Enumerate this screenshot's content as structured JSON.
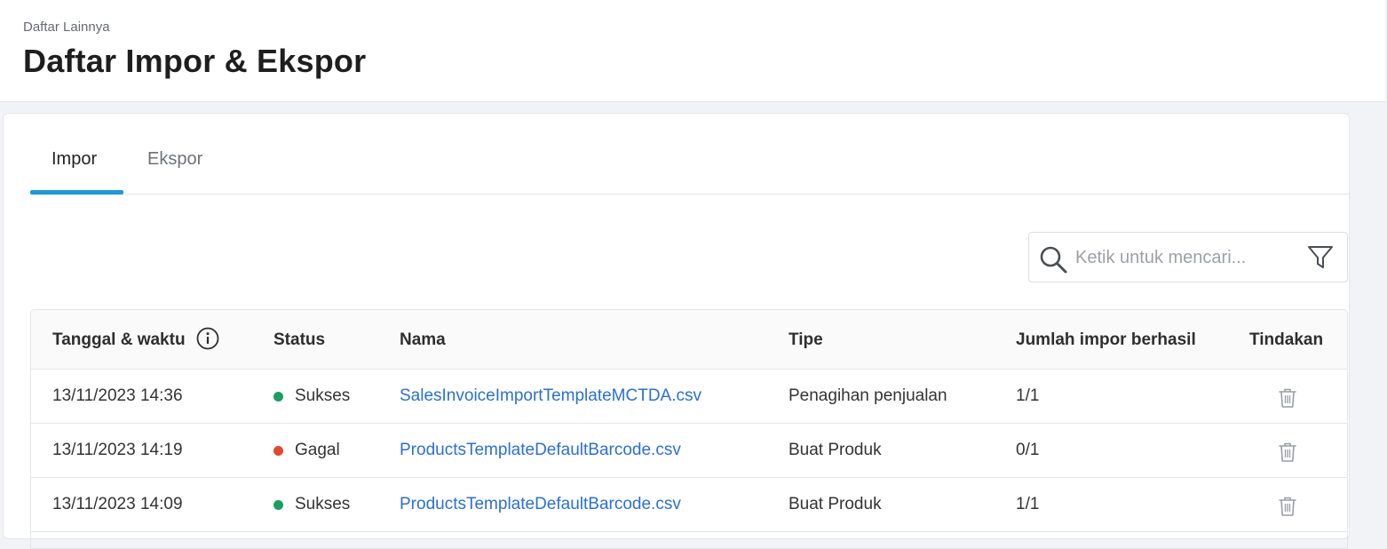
{
  "header": {
    "breadcrumb": "Daftar Lainnya",
    "title": "Daftar Impor & Ekspor"
  },
  "tabs": [
    {
      "label": "Impor",
      "active": true
    },
    {
      "label": "Ekspor",
      "active": false
    }
  ],
  "search": {
    "placeholder": "Ketik untuk mencari...",
    "value": ""
  },
  "table": {
    "columns": [
      "Tanggal & waktu",
      "Status",
      "Nama",
      "Tipe",
      "Jumlah impor berhasil",
      "Tindakan"
    ],
    "rows": [
      {
        "datetime": "13/11/2023 14:36",
        "status": "Sukses",
        "name": "SalesInvoiceImportTemplateMCTDA.csv",
        "type": "Penagihan penjualan",
        "count": "1/1"
      },
      {
        "datetime": "13/11/2023 14:19",
        "status": "Gagal",
        "name": "ProductsTemplateDefaultBarcode.csv",
        "type": "Buat Produk",
        "count": "0/1"
      },
      {
        "datetime": "13/11/2023 14:09",
        "status": "Sukses",
        "name": "ProductsTemplateDefaultBarcode.csv",
        "type": "Buat Produk",
        "count": "1/1"
      }
    ]
  },
  "colors": {
    "accent": "#1d9ad9",
    "success": "#1a9e62",
    "failed": "#e04a2f",
    "link": "#2b6fd6"
  },
  "icons": {
    "search": "search-icon",
    "filter": "filter-icon",
    "info": "info-icon",
    "delete": "trash-icon"
  }
}
